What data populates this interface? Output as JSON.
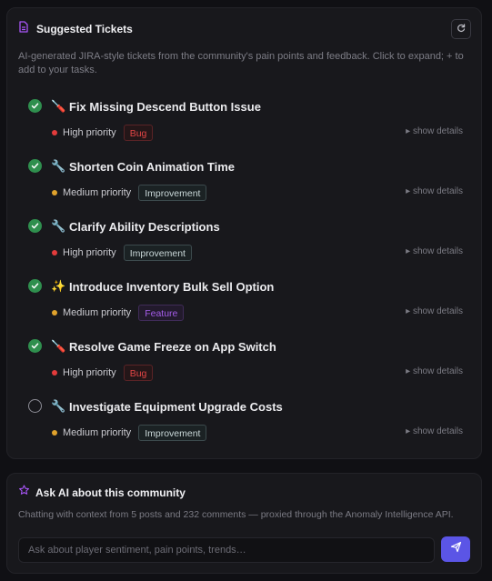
{
  "colors": {
    "accent": "#5b55e6",
    "high_priority": "#e23b3b",
    "medium_priority": "#e0a22c",
    "done": "#2f8f4e",
    "header_icon": "#a855f7"
  },
  "tickets_panel": {
    "title": "Suggested Tickets",
    "title_icon": "document-icon",
    "refresh_icon": "refresh-icon",
    "description": "AI-generated JIRA-style tickets from the community's pain points and feedback. Click to expand; + to add to your tasks.",
    "tickets": [
      {
        "done": true,
        "icon": "🪛",
        "title": "Fix Missing Descend Button Issue",
        "priority": "High priority",
        "level": "high",
        "tag": "Bug",
        "tag_type": "bug",
        "more": "▸ show details"
      },
      {
        "done": true,
        "icon": "🔧",
        "title": "Shorten Coin Animation Time",
        "priority": "Medium priority",
        "level": "medium",
        "tag": "Improvement",
        "tag_type": "improvement",
        "more": "▸ show details"
      },
      {
        "done": true,
        "icon": "🔧",
        "title": "Clarify Ability Descriptions",
        "priority": "High priority",
        "level": "high",
        "tag": "Improvement",
        "tag_type": "improvement",
        "more": "▸ show details"
      },
      {
        "done": true,
        "icon": "✨",
        "title": "Introduce Inventory Bulk Sell Option",
        "priority": "Medium priority",
        "level": "medium",
        "tag": "Feature",
        "tag_type": "feature",
        "more": "▸ show details"
      },
      {
        "done": true,
        "icon": "🪛",
        "title": "Resolve Game Freeze on App Switch",
        "priority": "High priority",
        "level": "high",
        "tag": "Bug",
        "tag_type": "bug",
        "more": "▸ show details"
      },
      {
        "done": false,
        "icon": "🔧",
        "title": "Investigate Equipment Upgrade Costs",
        "priority": "Medium priority",
        "level": "medium",
        "tag": "Improvement",
        "tag_type": "improvement",
        "more": "▸ show details"
      }
    ]
  },
  "ask_panel": {
    "title": "Ask AI about this community",
    "title_icon": "sparkle-icon",
    "description": "Chatting with context from 5 posts and 232 comments — proxied through the Anomaly Intelligence API.",
    "input_placeholder": "Ask about player sentiment, pain points, trends…",
    "input_value": "",
    "send_icon": "send-icon"
  }
}
